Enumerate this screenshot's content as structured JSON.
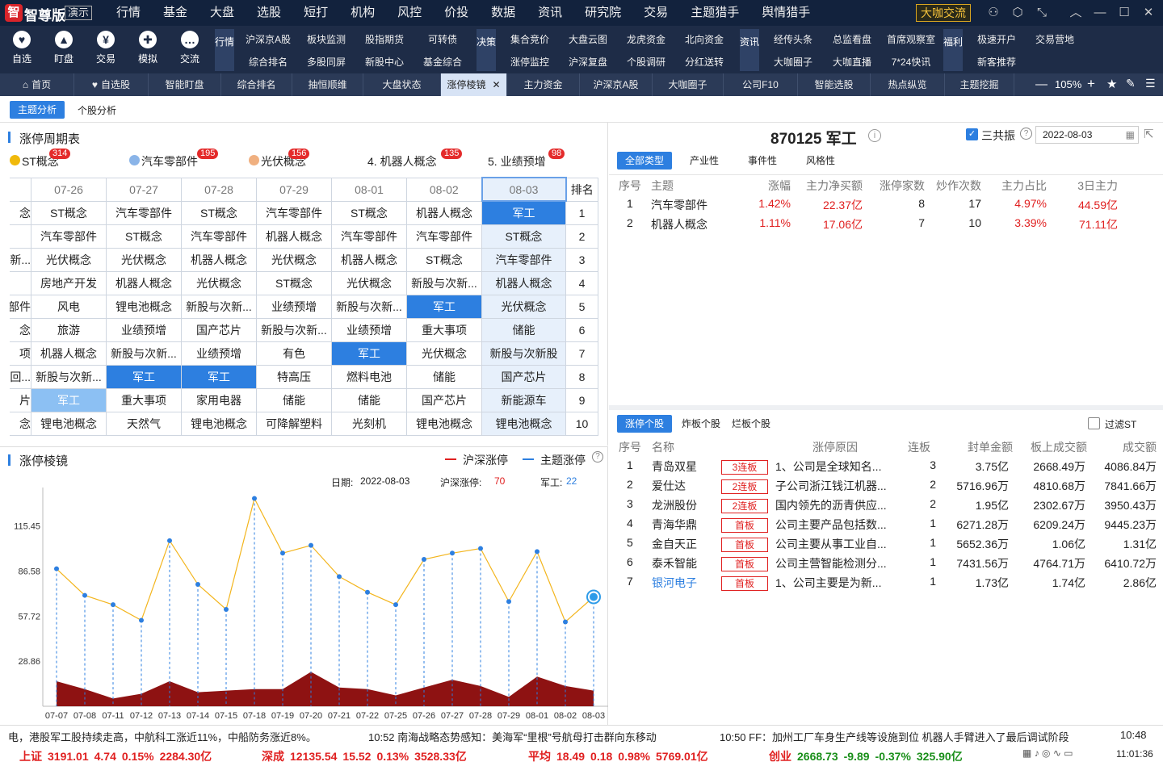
{
  "titlebar": {
    "logo": "智",
    "brand": "智尊版",
    "edition": "演示",
    "menu": [
      "行情",
      "基金",
      "大盘",
      "选股",
      "短打",
      "机构",
      "风控",
      "价投",
      "数据",
      "资讯",
      "研究院",
      "交易",
      "主题猎手",
      "舆情猎手"
    ],
    "dakai": "大咖交流"
  },
  "toolbar": {
    "big": [
      {
        "icon": "heart-icon",
        "glyph": "♥",
        "label": "自选"
      },
      {
        "icon": "chart-icon",
        "glyph": "▲",
        "label": "盯盘"
      },
      {
        "icon": "yen-icon",
        "glyph": "¥",
        "label": "交易"
      },
      {
        "icon": "gamepad-icon",
        "glyph": "✚",
        "label": "模拟"
      },
      {
        "icon": "chat-icon",
        "glyph": "…",
        "label": "交流"
      }
    ],
    "sections": [
      {
        "label": "行情",
        "items": [
          "沪深京A股",
          "板块监测",
          "股指期货",
          "可转债",
          "综合排名",
          "多股同屏",
          "新股中心",
          "基金综合"
        ]
      },
      {
        "label": "决策",
        "items": [
          "集合竞价",
          "大盘云图",
          "龙虎资金",
          "北向资金",
          "涨停监控",
          "沪深复盘",
          "个股调研",
          "分红送转"
        ]
      },
      {
        "label": "资讯",
        "items": [
          "经传头条",
          "总监看盘",
          "首席观察室",
          "大咖圈子",
          "大咖直播",
          "7*24快讯"
        ]
      },
      {
        "label": "福利",
        "items": [
          "极速开户",
          "交易营地",
          "新客推荐"
        ]
      }
    ]
  },
  "tabs": [
    "首页",
    "自选股",
    "智能盯盘",
    "综合排名",
    "抽恒顺维",
    "大盘状态",
    "涨停棱镜",
    "主力资金",
    "沪深京A股",
    "大咖圈子",
    "公司F10",
    "智能选股",
    "热点纵览",
    "主题挖掘"
  ],
  "zoom": "105%",
  "subtabs": {
    "active": "主题分析",
    "other": "个股分析"
  },
  "cycle": {
    "title": "涨停周期表",
    "themes": [
      {
        "label": "ST概念",
        "count": "314",
        "color": "#f0b90b"
      },
      {
        "label": "汽车零部件",
        "count": "195",
        "color": "#8ab4e8"
      },
      {
        "label": "光伏概念",
        "count": "156",
        "color": "#f0b080"
      },
      {
        "label": "4. 机器人概念",
        "count": "135",
        "color": ""
      },
      {
        "label": "5. 业绩预增",
        "count": "98",
        "color": ""
      }
    ],
    "dates": [
      "07-26",
      "07-27",
      "07-28",
      "07-29",
      "08-01",
      "08-02",
      "08-03"
    ],
    "rank_header": "排名",
    "rows": [
      {
        "rank": "1",
        "first": "念",
        "cells": [
          "ST概念",
          "汽车零部件",
          "ST概念",
          "汽车零部件",
          "ST概念",
          "机器人概念",
          "军工"
        ]
      },
      {
        "rank": "2",
        "first": "",
        "cells": [
          "汽车零部件",
          "ST概念",
          "汽车零部件",
          "机器人概念",
          "汽车零部件",
          "汽车零部件",
          "ST概念"
        ]
      },
      {
        "rank": "3",
        "first": "新...",
        "cells": [
          "光伏概念",
          "光伏概念",
          "机器人概念",
          "光伏概念",
          "机器人概念",
          "ST概念",
          "汽车零部件"
        ]
      },
      {
        "rank": "4",
        "first": "",
        "cells": [
          "房地产开发",
          "机器人概念",
          "光伏概念",
          "ST概念",
          "光伏概念",
          "新股与次新...",
          "机器人概念"
        ]
      },
      {
        "rank": "5",
        "first": "部件",
        "cells": [
          "风电",
          "锂电池概念",
          "新股与次新...",
          "业绩预增",
          "新股与次新...",
          "军工",
          "光伏概念"
        ]
      },
      {
        "rank": "6",
        "first": "念",
        "cells": [
          "旅游",
          "业绩预增",
          "国产芯片",
          "新股与次新...",
          "业绩预增",
          "重大事项",
          "储能"
        ]
      },
      {
        "rank": "7",
        "first": "项",
        "cells": [
          "机器人概念",
          "新股与次新...",
          "业绩预增",
          "有色",
          "军工",
          "光伏概念",
          "新股与次新股"
        ]
      },
      {
        "rank": "8",
        "first": "回...",
        "cells": [
          "新股与次新...",
          "军工",
          "军工",
          "特高压",
          "燃料电池",
          "储能",
          "国产芯片"
        ]
      },
      {
        "rank": "9",
        "first": "片",
        "cells": [
          "军工",
          "重大事项",
          "家用电器",
          "储能",
          "储能",
          "国产芯片",
          "新能源车"
        ]
      },
      {
        "rank": "10",
        "first": "念",
        "cells": [
          "锂电池概念",
          "天然气",
          "锂电池概念",
          "可降解塑料",
          "光刻机",
          "锂电池概念",
          "锂电池概念"
        ]
      }
    ]
  },
  "prism": {
    "title": "涨停棱镜",
    "legend1": "沪深涨停",
    "legend2": "主题涨停",
    "info": {
      "date_label": "日期:",
      "date": "2022-08-03",
      "hs_label": "沪深涨停:",
      "hs": "70",
      "theme_label": "军工:",
      "theme": "22"
    }
  },
  "chart_data": {
    "type": "line",
    "title": "涨停棱镜",
    "x": [
      "07-07",
      "07-08",
      "07-11",
      "07-12",
      "07-13",
      "07-14",
      "07-15",
      "07-18",
      "07-19",
      "07-20",
      "07-21",
      "07-22",
      "07-25",
      "07-26",
      "07-27",
      "07-28",
      "07-29",
      "08-01",
      "08-02",
      "08-03"
    ],
    "yticks": [
      "115.45",
      "86.58",
      "57.72",
      "28.86"
    ],
    "ylim": [
      0,
      140
    ],
    "series": [
      {
        "name": "沪深涨停",
        "values": [
          88,
          71,
          65,
          55,
          106,
          78,
          62,
          133,
          98,
          103,
          83,
          73,
          65,
          94,
          98,
          101,
          67,
          99,
          54,
          70
        ]
      },
      {
        "name": "主题涨停",
        "values": [
          16,
          11,
          5,
          8,
          16,
          9,
          10,
          11,
          11,
          22,
          12,
          11,
          7,
          12,
          17,
          13,
          6,
          19,
          13,
          10
        ]
      }
    ]
  },
  "stock": {
    "title": "870125 军工",
    "sangong": "三共振",
    "date": "2022-08-03",
    "filters": [
      "全部类型",
      "产业性",
      "事件性",
      "风格性"
    ],
    "headers": [
      "序号",
      "主题",
      "涨幅",
      "主力净买额",
      "涨停家数",
      "炒作次数",
      "主力占比",
      "3日主力"
    ],
    "rows": [
      {
        "no": "1",
        "theme": "汽车零部件",
        "pct": "1.42%",
        "net": "22.37亿",
        "zt": "8",
        "hype": "17",
        "ratio": "4.97%",
        "d3": "44.59亿"
      },
      {
        "no": "2",
        "theme": "机器人概念",
        "pct": "1.11%",
        "net": "17.06亿",
        "zt": "7",
        "hype": "10",
        "ratio": "3.39%",
        "d3": "71.11亿"
      }
    ]
  },
  "zt": {
    "tabs": [
      "涨停个股",
      "炸板个股",
      "烂板个股"
    ],
    "filter": "过滤ST",
    "headers": [
      "序号",
      "名称",
      "涨停原因",
      "连板",
      "封单金额",
      "板上成交额",
      "成交额"
    ],
    "rows": [
      {
        "no": "1",
        "name": "青岛双星",
        "tag": "3连板",
        "reason": "1、公司是全球知名...",
        "lb": "3",
        "seal": "3.75亿",
        "board": "2668.49万",
        "amount": "4086.84万"
      },
      {
        "no": "2",
        "name": "爱仕达",
        "tag": "2连板",
        "reason": "子公司浙江钱江机器...",
        "lb": "2",
        "seal": "5716.96万",
        "board": "4810.68万",
        "amount": "7841.66万"
      },
      {
        "no": "3",
        "name": "龙洲股份",
        "tag": "2连板",
        "reason": "国内领先的沥青供应...",
        "lb": "2",
        "seal": "1.95亿",
        "board": "2302.67万",
        "amount": "3950.43万"
      },
      {
        "no": "4",
        "name": "青海华鼎",
        "tag": "首板",
        "reason": "公司主要产品包括数...",
        "lb": "1",
        "seal": "6271.28万",
        "board": "6209.24万",
        "amount": "9445.23万"
      },
      {
        "no": "5",
        "name": "金自天正",
        "tag": "首板",
        "reason": "公司主要从事工业自...",
        "lb": "1",
        "seal": "5652.36万",
        "board": "1.06亿",
        "amount": "1.31亿"
      },
      {
        "no": "6",
        "name": "泰禾智能",
        "tag": "首板",
        "reason": "公司主营智能检测分...",
        "lb": "1",
        "seal": "7431.56万",
        "board": "4764.71万",
        "amount": "6410.72万"
      },
      {
        "no": "7",
        "name": "银河电子",
        "tag": "首板",
        "reason": "1、公司主要是为新...",
        "lb": "1",
        "seal": "1.73亿",
        "board": "1.74亿",
        "amount": "2.86亿"
      }
    ]
  },
  "ticker": {
    "a": "电，港股军工股持续走高，中航科工涨近11%，中船防务涨近8%。",
    "b": "10:52 南海战略态势感知：美海军“里根”号航母打击群向东移动",
    "c": "10:50 FF：加州工厂车身生产线等设施到位 机器人手臂进入了最后调试阶段",
    "d": "10:48"
  },
  "status": [
    {
      "name": "上证",
      "v": "3191.01",
      "c": "4.74",
      "p": "0.15%",
      "a": "2284.30亿",
      "color": "#e02020"
    },
    {
      "name": "深成",
      "v": "12135.54",
      "c": "15.52",
      "p": "0.13%",
      "a": "3528.33亿",
      "color": "#e02020"
    },
    {
      "name": "平均",
      "v": "18.49",
      "c": "0.18",
      "p": "0.98%",
      "a": "5769.01亿",
      "color": "#e02020"
    },
    {
      "name": "创业",
      "v": "2668.73",
      "c": "-9.89",
      "p": "-0.37%",
      "a": "325.90亿",
      "color": "#1a8f1a"
    }
  ],
  "clock": "11:01:36"
}
